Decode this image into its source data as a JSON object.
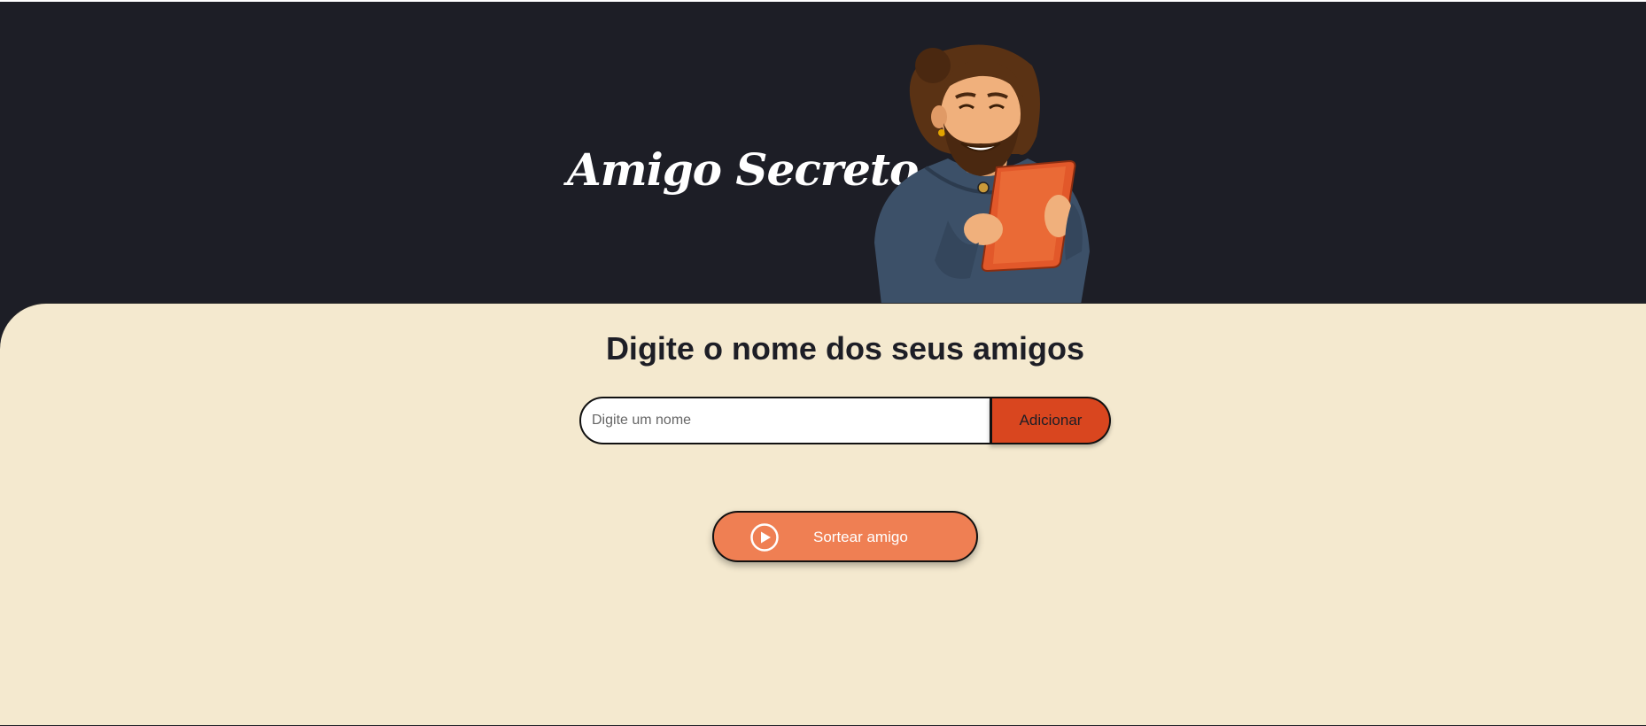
{
  "header": {
    "title": "Amigo Secreto"
  },
  "main": {
    "title": "Digite o nome dos seus amigos",
    "name_input": {
      "placeholder": "Digite um nome",
      "value": ""
    },
    "add_button_label": "Adicionar",
    "draw_button_label": "Sortear amigo",
    "draw_button_icon": "play-circle-icon"
  },
  "colors": {
    "header_background": "#1d1e26",
    "main_background": "#f4e9cf",
    "add_button": "#d9461f",
    "draw_button": "#ef7f53"
  }
}
